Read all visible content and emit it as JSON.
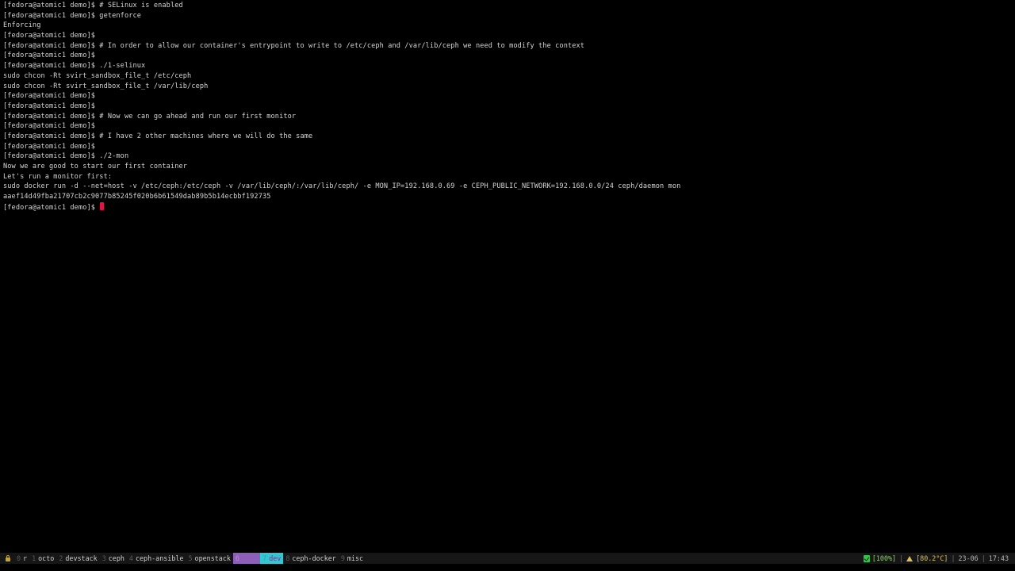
{
  "colors": {
    "background": "#000000",
    "text": "#d4d4d4",
    "cursor": "#e0144b",
    "statusbar_bg": "#161616",
    "workspace_purple": "#8e5fb8",
    "workspace_teal": "#35c7d1",
    "battery_green": "#35c24a",
    "temperature_yellow": "#d9c05a"
  },
  "terminal": {
    "lines": [
      "[fedora@atomic1 demo]$ # SELinux is enabled",
      "[fedora@atomic1 demo]$ getenforce",
      "Enforcing",
      "[fedora@atomic1 demo]$",
      "[fedora@atomic1 demo]$ # In order to allow our container's entrypoint to write to /etc/ceph and /var/lib/ceph we need to modify the context",
      "[fedora@atomic1 demo]$",
      "[fedora@atomic1 demo]$ ./1-selinux",
      "sudo chcon -Rt svirt_sandbox_file_t /etc/ceph",
      "sudo chcon -Rt svirt_sandbox_file_t /var/lib/ceph",
      "[fedora@atomic1 demo]$",
      "[fedora@atomic1 demo]$",
      "[fedora@atomic1 demo]$ # Now we can go ahead and run our first monitor",
      "[fedora@atomic1 demo]$",
      "[fedora@atomic1 demo]$ # I have 2 other machines where we will do the same",
      "[fedora@atomic1 demo]$",
      "[fedora@atomic1 demo]$ ./2-mon",
      "Now we are good to start our first container",
      "Let's run a monitor first:",
      "sudo docker run -d --net=host -v /etc/ceph:/etc/ceph -v /var/lib/ceph/:/var/lib/ceph/ -e MON_IP=192.168.0.69 -e CEPH_PUBLIC_NETWORK=192.168.0.0/24 ceph/daemon mon",
      "aaef14d49fba21707cb2c9077b85245f020b6b61549dab89b5b14ecbbf192735",
      "[fedora@atomic1 demo]$ "
    ]
  },
  "statusbar": {
    "workspaces": [
      {
        "num": "0",
        "label": "r"
      },
      {
        "num": "1",
        "label": "octo"
      },
      {
        "num": "2",
        "label": "devstack"
      },
      {
        "num": "3",
        "label": "ceph"
      },
      {
        "num": "4",
        "label": "ceph-ansible"
      },
      {
        "num": "5",
        "label": "openstack"
      },
      {
        "num": "6",
        "label": "test"
      },
      {
        "num": "7",
        "label": "dev"
      },
      {
        "num": "8",
        "label": "ceph-docker"
      },
      {
        "num": "9",
        "label": "misc"
      }
    ],
    "battery": "[100%]",
    "temperature": "[80.2°C]",
    "date": "23-06",
    "time": "17:43"
  }
}
